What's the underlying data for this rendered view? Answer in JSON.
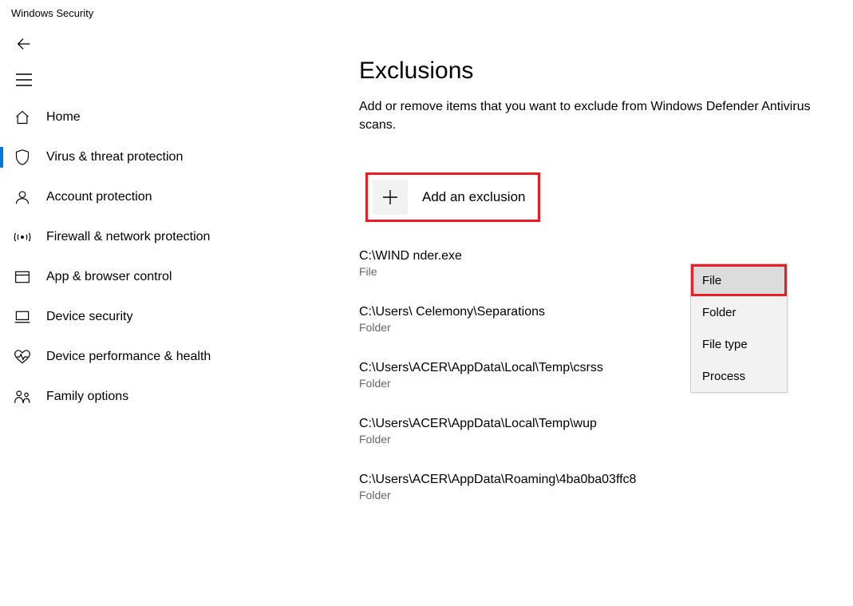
{
  "app": {
    "title": "Windows Security"
  },
  "sidebar": {
    "items": [
      {
        "icon": "home-icon",
        "label": "Home"
      },
      {
        "icon": "shield-icon",
        "label": "Virus & threat protection",
        "active": true
      },
      {
        "icon": "person-icon",
        "label": "Account protection"
      },
      {
        "icon": "signal-icon",
        "label": "Firewall & network protection"
      },
      {
        "icon": "window-icon",
        "label": "App & browser control"
      },
      {
        "icon": "laptop-icon",
        "label": "Device security"
      },
      {
        "icon": "heart-icon",
        "label": "Device performance & health"
      },
      {
        "icon": "family-icon",
        "label": "Family options"
      }
    ]
  },
  "page": {
    "title": "Exclusions",
    "description": "Add or remove items that you want to exclude from Windows Defender Antivirus scans.",
    "add_button_label": "Add an exclusion"
  },
  "dropdown": {
    "items": [
      "File",
      "Folder",
      "File type",
      "Process"
    ],
    "highlighted": "File"
  },
  "exclusions": [
    {
      "path": "C:\\WIND                                  nder.exe",
      "kind": "File"
    },
    {
      "path": "C:\\Users\\                                  Celemony\\Separations",
      "kind": "Folder"
    },
    {
      "path": "C:\\Users\\ACER\\AppData\\Local\\Temp\\csrss",
      "kind": "Folder"
    },
    {
      "path": "C:\\Users\\ACER\\AppData\\Local\\Temp\\wup",
      "kind": "Folder"
    },
    {
      "path": "C:\\Users\\ACER\\AppData\\Roaming\\4ba0ba03ffc8",
      "kind": "Folder"
    }
  ]
}
